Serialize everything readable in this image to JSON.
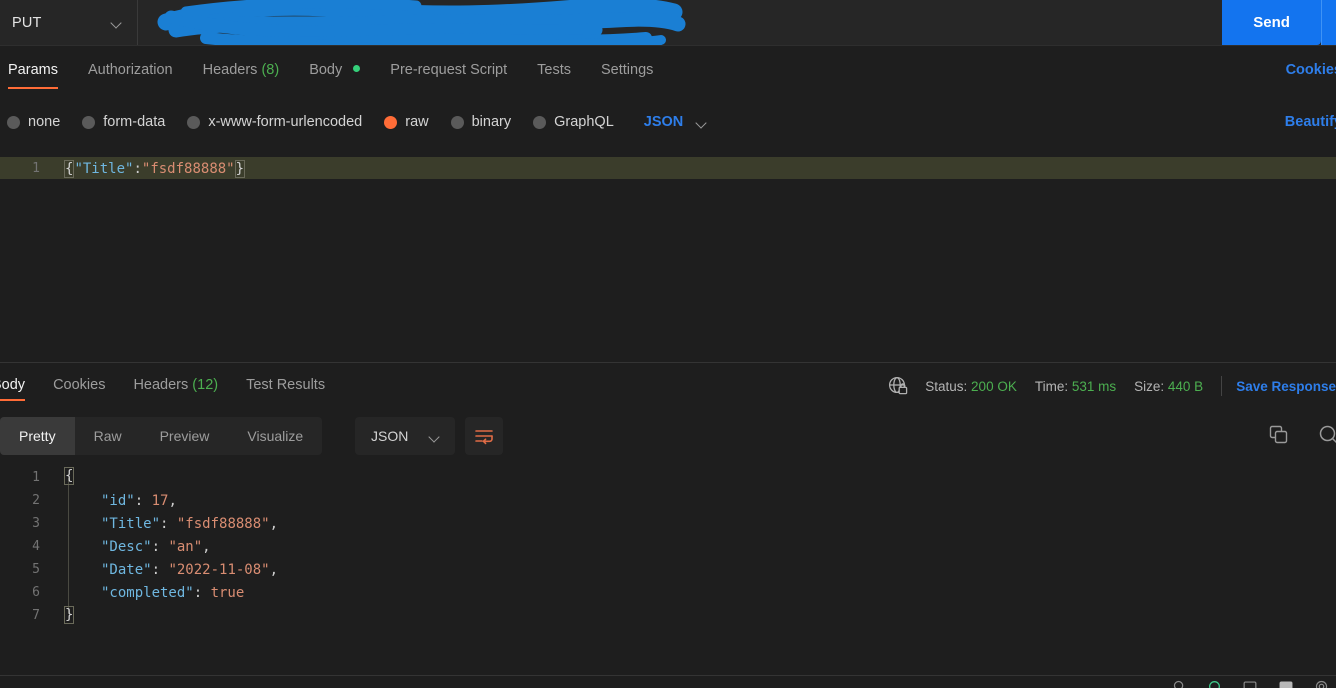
{
  "request_bar": {
    "method": "PUT",
    "url_text": "",
    "url_redacted": true,
    "send_label": "Send"
  },
  "request_tabs": {
    "items": [
      {
        "label": "Params",
        "count": "",
        "active": false,
        "dot": false
      },
      {
        "label": "Authorization",
        "count": "",
        "active": false,
        "dot": false
      },
      {
        "label": "Headers",
        "count": "(8)",
        "active": false,
        "dot": false
      },
      {
        "label": "Body",
        "count": "",
        "active": true,
        "dot": true
      },
      {
        "label": "Pre-request Script",
        "count": "",
        "active": false,
        "dot": false
      },
      {
        "label": "Tests",
        "count": "",
        "active": false,
        "dot": false
      },
      {
        "label": "Settings",
        "count": "",
        "active": false,
        "dot": false
      }
    ],
    "cookies_link": "Cookies"
  },
  "body_type": {
    "options": [
      {
        "label": "none",
        "selected": false
      },
      {
        "label": "form-data",
        "selected": false
      },
      {
        "label": "x-www-form-urlencoded",
        "selected": false
      },
      {
        "label": "raw",
        "selected": true
      },
      {
        "label": "binary",
        "selected": false
      },
      {
        "label": "GraphQL",
        "selected": false
      }
    ],
    "format": "JSON",
    "beautify_link": "Beautify"
  },
  "request_body": {
    "line_number": "1",
    "open_brace": "{",
    "key": "\"Title\"",
    "colon": ":",
    "value": "\"fsdf88888\"",
    "close_brace": "}"
  },
  "response_tabs": {
    "items": [
      {
        "label": "Body",
        "count": "",
        "active": true
      },
      {
        "label": "Cookies",
        "count": "",
        "active": false
      },
      {
        "label": "Headers",
        "count": "(12)",
        "active": false
      },
      {
        "label": "Test Results",
        "count": "",
        "active": false
      }
    ]
  },
  "response_meta": {
    "status_label": "Status:",
    "status_value": "200 OK",
    "time_label": "Time:",
    "time_value": "531 ms",
    "size_label": "Size:",
    "size_value": "440 B",
    "save_response": "Save Response"
  },
  "response_toolbar": {
    "views": [
      {
        "label": "Pretty",
        "active": true
      },
      {
        "label": "Raw",
        "active": false
      },
      {
        "label": "Preview",
        "active": false
      },
      {
        "label": "Visualize",
        "active": false
      }
    ],
    "format": "JSON"
  },
  "response_body": {
    "lines": [
      {
        "n": "1",
        "indent": 0,
        "tokens": [
          {
            "t": "brace",
            "v": "{"
          }
        ]
      },
      {
        "n": "2",
        "indent": 1,
        "tokens": [
          {
            "t": "key",
            "v": "\"id\""
          },
          {
            "t": "punc",
            "v": ": "
          },
          {
            "t": "num",
            "v": "17"
          },
          {
            "t": "punc",
            "v": ","
          }
        ]
      },
      {
        "n": "3",
        "indent": 1,
        "tokens": [
          {
            "t": "key",
            "v": "\"Title\""
          },
          {
            "t": "punc",
            "v": ": "
          },
          {
            "t": "str",
            "v": "\"fsdf88888\""
          },
          {
            "t": "punc",
            "v": ","
          }
        ]
      },
      {
        "n": "4",
        "indent": 1,
        "tokens": [
          {
            "t": "key",
            "v": "\"Desc\""
          },
          {
            "t": "punc",
            "v": ": "
          },
          {
            "t": "str",
            "v": "\"an\""
          },
          {
            "t": "punc",
            "v": ","
          }
        ]
      },
      {
        "n": "5",
        "indent": 1,
        "tokens": [
          {
            "t": "key",
            "v": "\"Date\""
          },
          {
            "t": "punc",
            "v": ": "
          },
          {
            "t": "str",
            "v": "\"2022-11-08\""
          },
          {
            "t": "punc",
            "v": ","
          }
        ]
      },
      {
        "n": "6",
        "indent": 1,
        "tokens": [
          {
            "t": "key",
            "v": "\"completed\""
          },
          {
            "t": "punc",
            "v": ": "
          },
          {
            "t": "bool",
            "v": "true"
          }
        ]
      },
      {
        "n": "7",
        "indent": 0,
        "tokens": [
          {
            "t": "brace",
            "v": "}"
          }
        ]
      }
    ]
  },
  "colors": {
    "accent_orange": "#ff6c37",
    "link_blue": "#2e7eea",
    "send_blue": "#1374ef",
    "status_green": "#4caf50",
    "redaction_blue": "#1a7fd4"
  }
}
